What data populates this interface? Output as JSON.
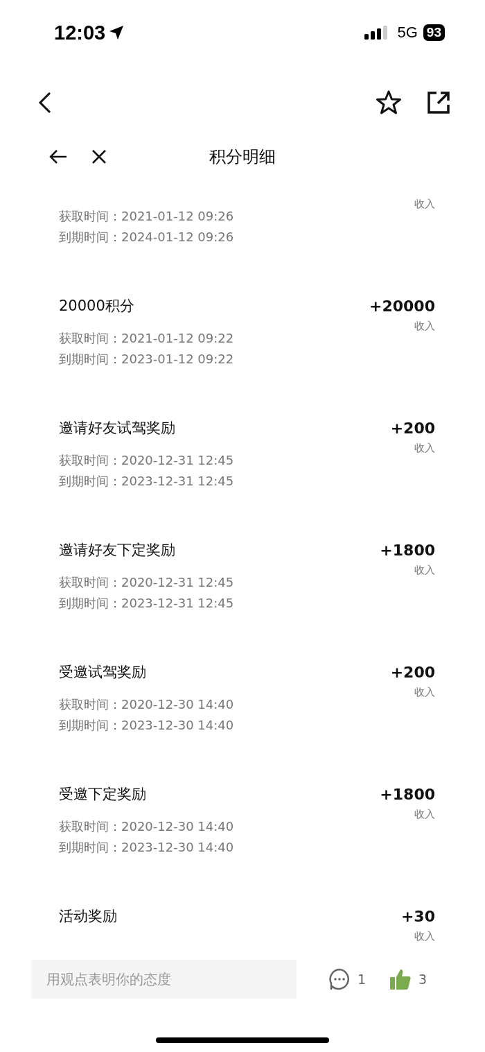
{
  "status_bar": {
    "time": "12:03",
    "network": "5G",
    "battery": "93"
  },
  "page_header": {
    "title": "积分明细"
  },
  "items": [
    {
      "label": "收入",
      "acquired": "获取时间：2021-01-12 09:26",
      "expires": "到期时间：2024-01-12 09:26"
    },
    {
      "title": "20000积分",
      "amount": "+20000",
      "label": "收入",
      "acquired": "获取时间：2021-01-12 09:22",
      "expires": "到期时间：2023-01-12 09:22"
    },
    {
      "title": "邀请好友试驾奖励",
      "amount": "+200",
      "label": "收入",
      "acquired": "获取时间：2020-12-31 12:45",
      "expires": "到期时间：2023-12-31 12:45"
    },
    {
      "title": "邀请好友下定奖励",
      "amount": "+1800",
      "label": "收入",
      "acquired": "获取时间：2020-12-31 12:45",
      "expires": "到期时间：2023-12-31 12:45"
    },
    {
      "title": "受邀试驾奖励",
      "amount": "+200",
      "label": "收入",
      "acquired": "获取时间：2020-12-30 14:40",
      "expires": "到期时间：2023-12-30 14:40"
    },
    {
      "title": "受邀下定奖励",
      "amount": "+1800",
      "label": "收入",
      "acquired": "获取时间：2020-12-30 14:40",
      "expires": "到期时间：2023-12-30 14:40"
    },
    {
      "title": "活动奖励",
      "amount": "+30",
      "label": "收入"
    }
  ],
  "bottom_bar": {
    "placeholder": "用观点表明你的态度",
    "comment_count": "1",
    "like_count": "3",
    "liked": true
  }
}
